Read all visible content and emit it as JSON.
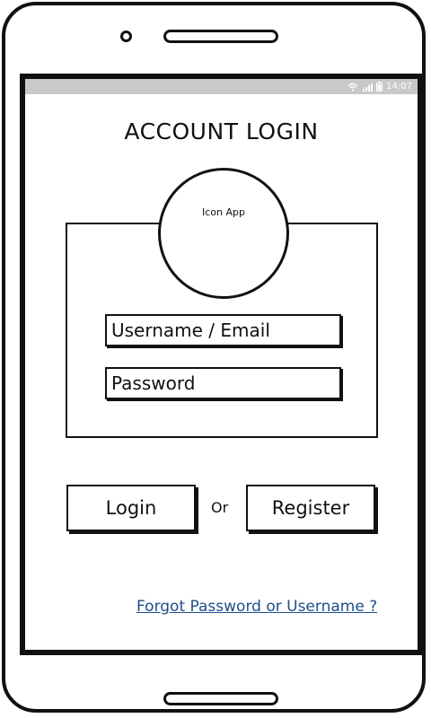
{
  "status_bar": {
    "time": "14:07",
    "icons": [
      "wifi-icon",
      "signal-icon",
      "battery-icon"
    ]
  },
  "screen": {
    "title": "ACCOUNT LOGIN",
    "app_icon_label": "Icon App",
    "username_placeholder": "Username / Email",
    "password_placeholder": "Password",
    "login_label": "Login",
    "or_label": "Or",
    "register_label": "Register",
    "forgot_link": "Forgot Password or Username ?"
  },
  "colors": {
    "link": "#1f4e8c",
    "status_bar": "#c9c9c9",
    "outline": "#111111"
  }
}
